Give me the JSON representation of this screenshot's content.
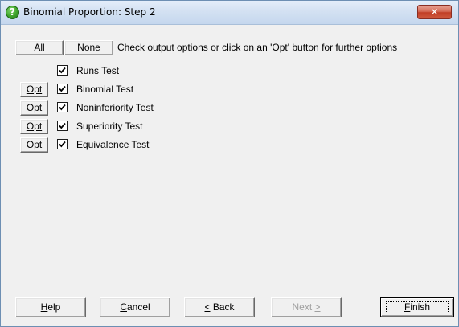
{
  "window": {
    "title": "Binomial Proportion: Step 2",
    "title_icon": "help-question-icon",
    "close_icon": "close-x-icon",
    "close_glyph": "✕"
  },
  "top_buttons": {
    "all_label": "All",
    "none_label": "None"
  },
  "instruction": "Check output options or click on an 'Opt' button for further options",
  "options": [
    {
      "label": "Runs Test",
      "checked": true,
      "has_opt": false
    },
    {
      "label": "Binomial Test",
      "checked": true,
      "has_opt": true,
      "opt_label": "Opt"
    },
    {
      "label": "Noninferiority Test",
      "checked": true,
      "has_opt": true,
      "opt_label": "Opt"
    },
    {
      "label": "Superiority Test",
      "checked": true,
      "has_opt": true,
      "opt_label": "Opt"
    },
    {
      "label": "Equivalence Test",
      "checked": true,
      "has_opt": true,
      "opt_label": "Opt"
    }
  ],
  "bottom_buttons": {
    "help": {
      "label": "Help",
      "mnemonic": "H",
      "rest": "elp",
      "enabled": true
    },
    "cancel": {
      "label": "Cancel",
      "mnemonic": "C",
      "rest": "ancel",
      "enabled": true
    },
    "back": {
      "label": "< Back",
      "mnemonic": "<",
      "rest": " Back",
      "enabled": true
    },
    "next": {
      "label": "Next >",
      "prefix": "Next ",
      "mnemonic": ">",
      "enabled": false
    },
    "finish": {
      "label": "Finish",
      "mnemonic": "F",
      "rest": "inish",
      "enabled": true,
      "default": true
    }
  },
  "colors": {
    "dialog_bg": "#f0f0f0",
    "titlebar": "#d3e1f2",
    "close_button": "#c13e26",
    "disabled_text": "#a0a0a0"
  }
}
